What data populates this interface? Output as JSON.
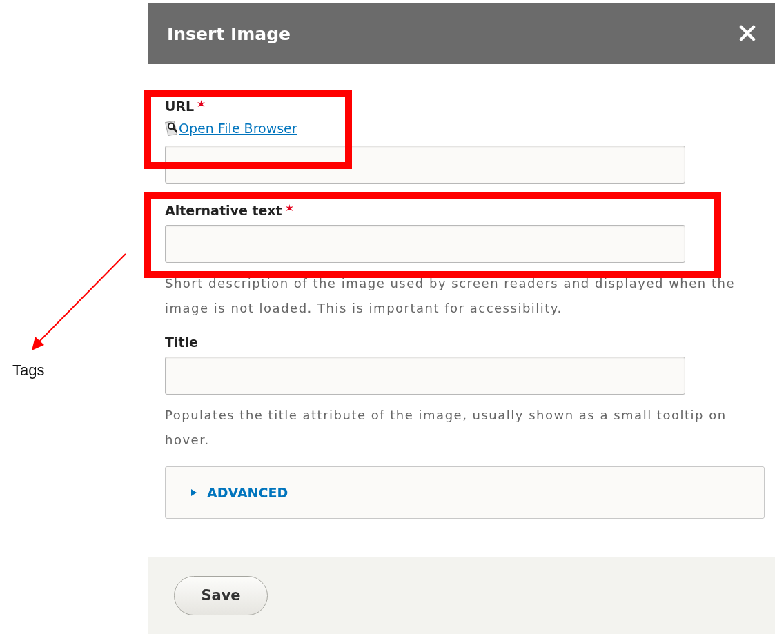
{
  "dialog": {
    "title": "Insert Image",
    "fields": [
      {
        "label": "URL",
        "required": true,
        "link": "Open File Browser"
      },
      {
        "label": "Alternative text",
        "required": true,
        "description": "Short description of the image used by screen readers and displayed when the image is not loaded. This is important for accessibility."
      },
      {
        "label": "Title",
        "required": false,
        "description": "Populates the title attribute of the image, usually shown as a small tooltip on hover."
      }
    ],
    "advanced": {
      "label": "ADVANCED",
      "expanded": false
    },
    "buttons": [
      "Save"
    ]
  },
  "annotation": {
    "label": "Tags"
  }
}
